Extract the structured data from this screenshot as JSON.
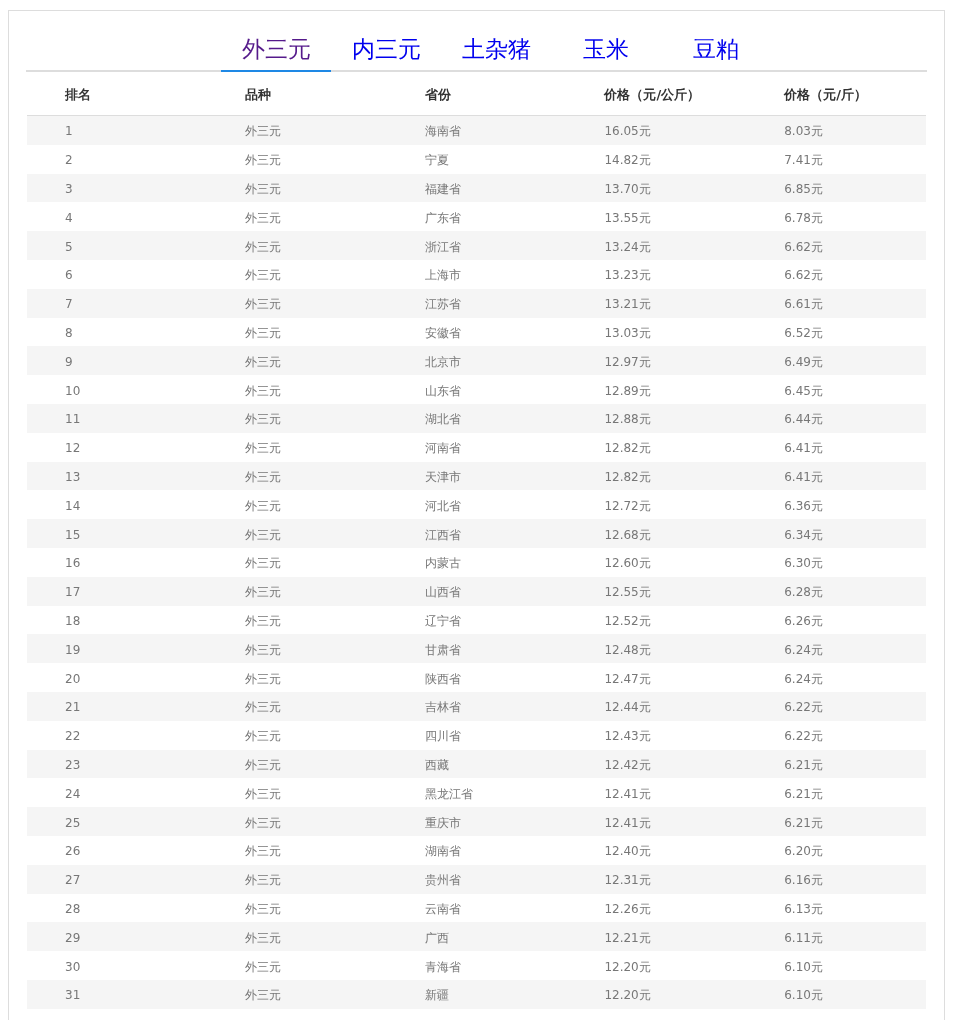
{
  "tabs": [
    {
      "label": "外三元",
      "selected": true
    },
    {
      "label": "内三元",
      "selected": false
    },
    {
      "label": "土杂猪",
      "selected": false
    },
    {
      "label": "玉米",
      "selected": false
    },
    {
      "label": "豆粕",
      "selected": false
    }
  ],
  "table": {
    "columns": [
      "排名",
      "品种",
      "省份",
      "价格（元/公斤）",
      "价格（元/斤）"
    ],
    "rows": [
      [
        "1",
        "外三元",
        "海南省",
        "16.05元",
        "8.03元"
      ],
      [
        "2",
        "外三元",
        "宁夏",
        "14.82元",
        "7.41元"
      ],
      [
        "3",
        "外三元",
        "福建省",
        "13.70元",
        "6.85元"
      ],
      [
        "4",
        "外三元",
        "广东省",
        "13.55元",
        "6.78元"
      ],
      [
        "5",
        "外三元",
        "浙江省",
        "13.24元",
        "6.62元"
      ],
      [
        "6",
        "外三元",
        "上海市",
        "13.23元",
        "6.62元"
      ],
      [
        "7",
        "外三元",
        "江苏省",
        "13.21元",
        "6.61元"
      ],
      [
        "8",
        "外三元",
        "安徽省",
        "13.03元",
        "6.52元"
      ],
      [
        "9",
        "外三元",
        "北京市",
        "12.97元",
        "6.49元"
      ],
      [
        "10",
        "外三元",
        "山东省",
        "12.89元",
        "6.45元"
      ],
      [
        "11",
        "外三元",
        "湖北省",
        "12.88元",
        "6.44元"
      ],
      [
        "12",
        "外三元",
        "河南省",
        "12.82元",
        "6.41元"
      ],
      [
        "13",
        "外三元",
        "天津市",
        "12.82元",
        "6.41元"
      ],
      [
        "14",
        "外三元",
        "河北省",
        "12.72元",
        "6.36元"
      ],
      [
        "15",
        "外三元",
        "江西省",
        "12.68元",
        "6.34元"
      ],
      [
        "16",
        "外三元",
        "内蒙古",
        "12.60元",
        "6.30元"
      ],
      [
        "17",
        "外三元",
        "山西省",
        "12.55元",
        "6.28元"
      ],
      [
        "18",
        "外三元",
        "辽宁省",
        "12.52元",
        "6.26元"
      ],
      [
        "19",
        "外三元",
        "甘肃省",
        "12.48元",
        "6.24元"
      ],
      [
        "20",
        "外三元",
        "陕西省",
        "12.47元",
        "6.24元"
      ],
      [
        "21",
        "外三元",
        "吉林省",
        "12.44元",
        "6.22元"
      ],
      [
        "22",
        "外三元",
        "四川省",
        "12.43元",
        "6.22元"
      ],
      [
        "23",
        "外三元",
        "西藏",
        "12.42元",
        "6.21元"
      ],
      [
        "24",
        "外三元",
        "黑龙江省",
        "12.41元",
        "6.21元"
      ],
      [
        "25",
        "外三元",
        "重庆市",
        "12.41元",
        "6.21元"
      ],
      [
        "26",
        "外三元",
        "湖南省",
        "12.40元",
        "6.20元"
      ],
      [
        "27",
        "外三元",
        "贵州省",
        "12.31元",
        "6.16元"
      ],
      [
        "28",
        "外三元",
        "云南省",
        "12.26元",
        "6.13元"
      ],
      [
        "29",
        "外三元",
        "广西",
        "12.21元",
        "6.11元"
      ],
      [
        "30",
        "外三元",
        "青海省",
        "12.20元",
        "6.10元"
      ],
      [
        "31",
        "外三元",
        "新疆",
        "12.20元",
        "6.10元"
      ]
    ]
  }
}
